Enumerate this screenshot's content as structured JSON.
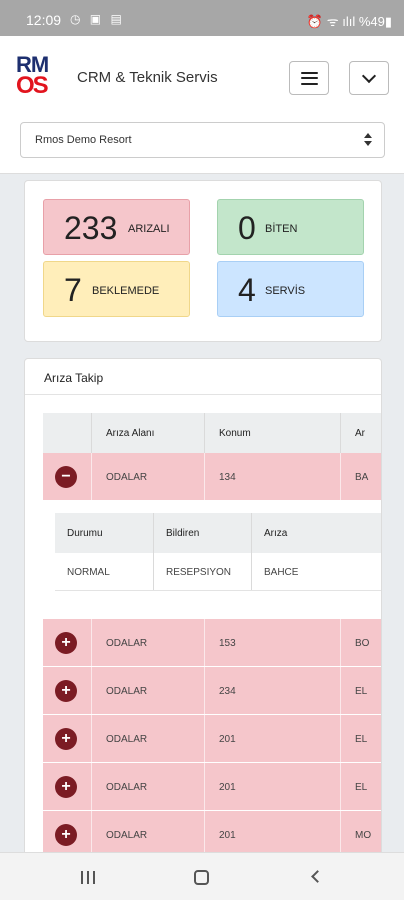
{
  "status_bar": {
    "time": "12:09",
    "left_icons": "◷ ▣ ▤",
    "right_icons": "⏰ ᯤ ılıl %49▮"
  },
  "header": {
    "logo_top": "RM",
    "logo_bottom": "OS",
    "title": "CRM & Teknik Servis"
  },
  "hotel_select": {
    "value": "Rmos Demo Resort"
  },
  "stats": [
    {
      "value": "233",
      "label": "ARIZALI"
    },
    {
      "value": "0",
      "label": "BİTEN"
    },
    {
      "value": "7",
      "label": "BEKLEMEDE"
    },
    {
      "value": "4",
      "label": "SERVİS"
    }
  ],
  "ariza": {
    "title": "Arıza Takip",
    "columns": [
      "",
      "Arıza Alanı",
      "Konum",
      "Ar"
    ],
    "rows": [
      {
        "alan": "ODALAR",
        "konum": "134",
        "ar": "BA",
        "expanded": true,
        "toggle": "−"
      },
      {
        "alan": "ODALAR",
        "konum": "153",
        "ar": "BO",
        "toggle": "+"
      },
      {
        "alan": "ODALAR",
        "konum": "234",
        "ar": "EL",
        "toggle": "+"
      },
      {
        "alan": "ODALAR",
        "konum": "201",
        "ar": "EL",
        "toggle": "+"
      },
      {
        "alan": "ODALAR",
        "konum": "201",
        "ar": "EL",
        "toggle": "+"
      },
      {
        "alan": "ODALAR",
        "konum": "201",
        "ar": "MO",
        "toggle": "+"
      }
    ],
    "detail": {
      "columns": [
        "Durumu",
        "Bildiren",
        "Arıza"
      ],
      "values": [
        "NORMAL",
        "RESEPSIYON",
        "BAHCE"
      ]
    }
  }
}
